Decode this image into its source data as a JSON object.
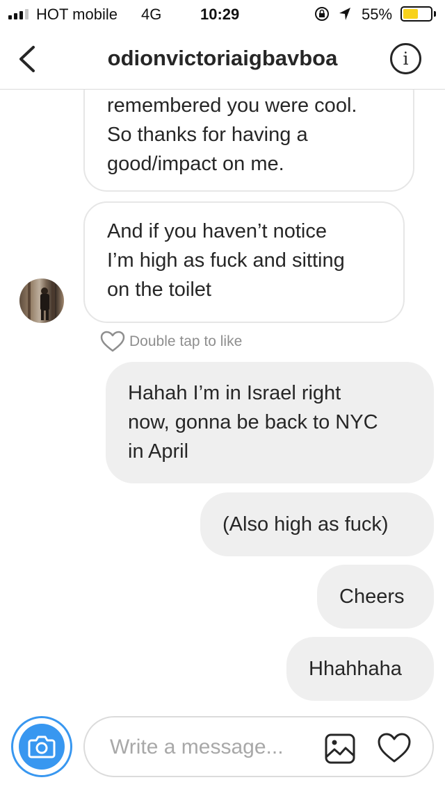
{
  "status_bar": {
    "carrier": "HOT mobile",
    "network": "4G",
    "time": "10:29",
    "battery_percent": "55%",
    "battery_level": 0.55,
    "battery_color": "#f8d21c"
  },
  "header": {
    "username": "odionvictoriaigbavboa",
    "info_glyph": "i",
    "back_icon": "chevron-left-icon"
  },
  "messages": [
    {
      "direction": "incoming",
      "lines": [
        "remembered you were cool.",
        "So thanks for having a",
        "good/impact on me."
      ]
    },
    {
      "direction": "incoming",
      "lines": [
        "And if you haven’t notice",
        "I’m high as fuck and sitting",
        "on the toilet"
      ]
    },
    {
      "direction": "outgoing",
      "lines": [
        "Hahah I’m in Israel right",
        "now, gonna be back to NYC",
        "in April"
      ]
    },
    {
      "direction": "outgoing",
      "lines": [
        "(Also high as fuck)"
      ]
    },
    {
      "direction": "outgoing",
      "lines": [
        "Cheers"
      ]
    },
    {
      "direction": "outgoing",
      "lines": [
        "Hhahhaha"
      ]
    }
  ],
  "like_hint": "Double tap to like",
  "composer": {
    "placeholder": "Write a message...",
    "camera_icon": "camera-icon",
    "gallery_icon": "image-gallery-icon",
    "heart_icon": "heart-icon",
    "accent_color": "#3897f0"
  }
}
